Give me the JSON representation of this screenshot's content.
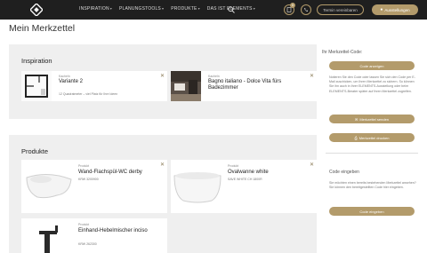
{
  "nav": {
    "items": [
      {
        "label": "INSPIRATION"
      },
      {
        "label": "PLANUNGSTOOLS"
      },
      {
        "label": "PRODUKTE"
      },
      {
        "label": "DAS IST ELEMENTS"
      }
    ],
    "cart_count": "0",
    "appointment_label": "Termin vereinbaren",
    "exhibitions_label": "Ausstellungen"
  },
  "page": {
    "title": "Mein Merkzettel"
  },
  "inspiration": {
    "heading": "Inspiration",
    "cards": [
      {
        "category": "Kacheln",
        "title": "Variante 2",
        "subtitle": "12 Quadratmeter – viel Platz für Ihre Ideen"
      },
      {
        "category": "Kacheln",
        "title": "Bagno italiano - Dolce Vita fürs Badezimmer",
        "subtitle": ""
      }
    ]
  },
  "products": {
    "heading": "Produkte",
    "cards": [
      {
        "category": "Produkt",
        "title": "Wand-Flachspül-WC derby",
        "subtitle": "KRW 3200900"
      },
      {
        "category": "Produkt",
        "title": "Ovalwanne white",
        "subtitle": "SAVE WHITE CH 1800R"
      },
      {
        "category": "Produkt",
        "title": "Einhand-Hebelmischer inciso",
        "subtitle": "KRW 262300"
      }
    ]
  },
  "sidebar": {
    "code_label": "Ihr Merkzettel-Code:",
    "show_code": "Code anzeigen",
    "code_text": "Notieren Sie den Code oder lassen Sie sich den Code per E-Mail zuschicken, um Ihren Merkzettel zu sichern. So können Sie ihn auch in Ihrer ELEMENTS-Ausstellung oder beim ELEMENTS-Berater später auf Ihren Merkzettel zugreifen.",
    "send_label": "Merkzettel senden",
    "print_label": "Merkzettel drucken",
    "enter_heading": "Code eingeben",
    "enter_text": "Sie möchten einen bereits bestehenden Merkzettel ansehen? Sie können den bereitgestellten Code hier eingeben.",
    "enter_button": "Code eingeben"
  },
  "colors": {
    "accent": "#b39b6b",
    "topbar": "#1f1f1f",
    "panel": "#efefef"
  }
}
